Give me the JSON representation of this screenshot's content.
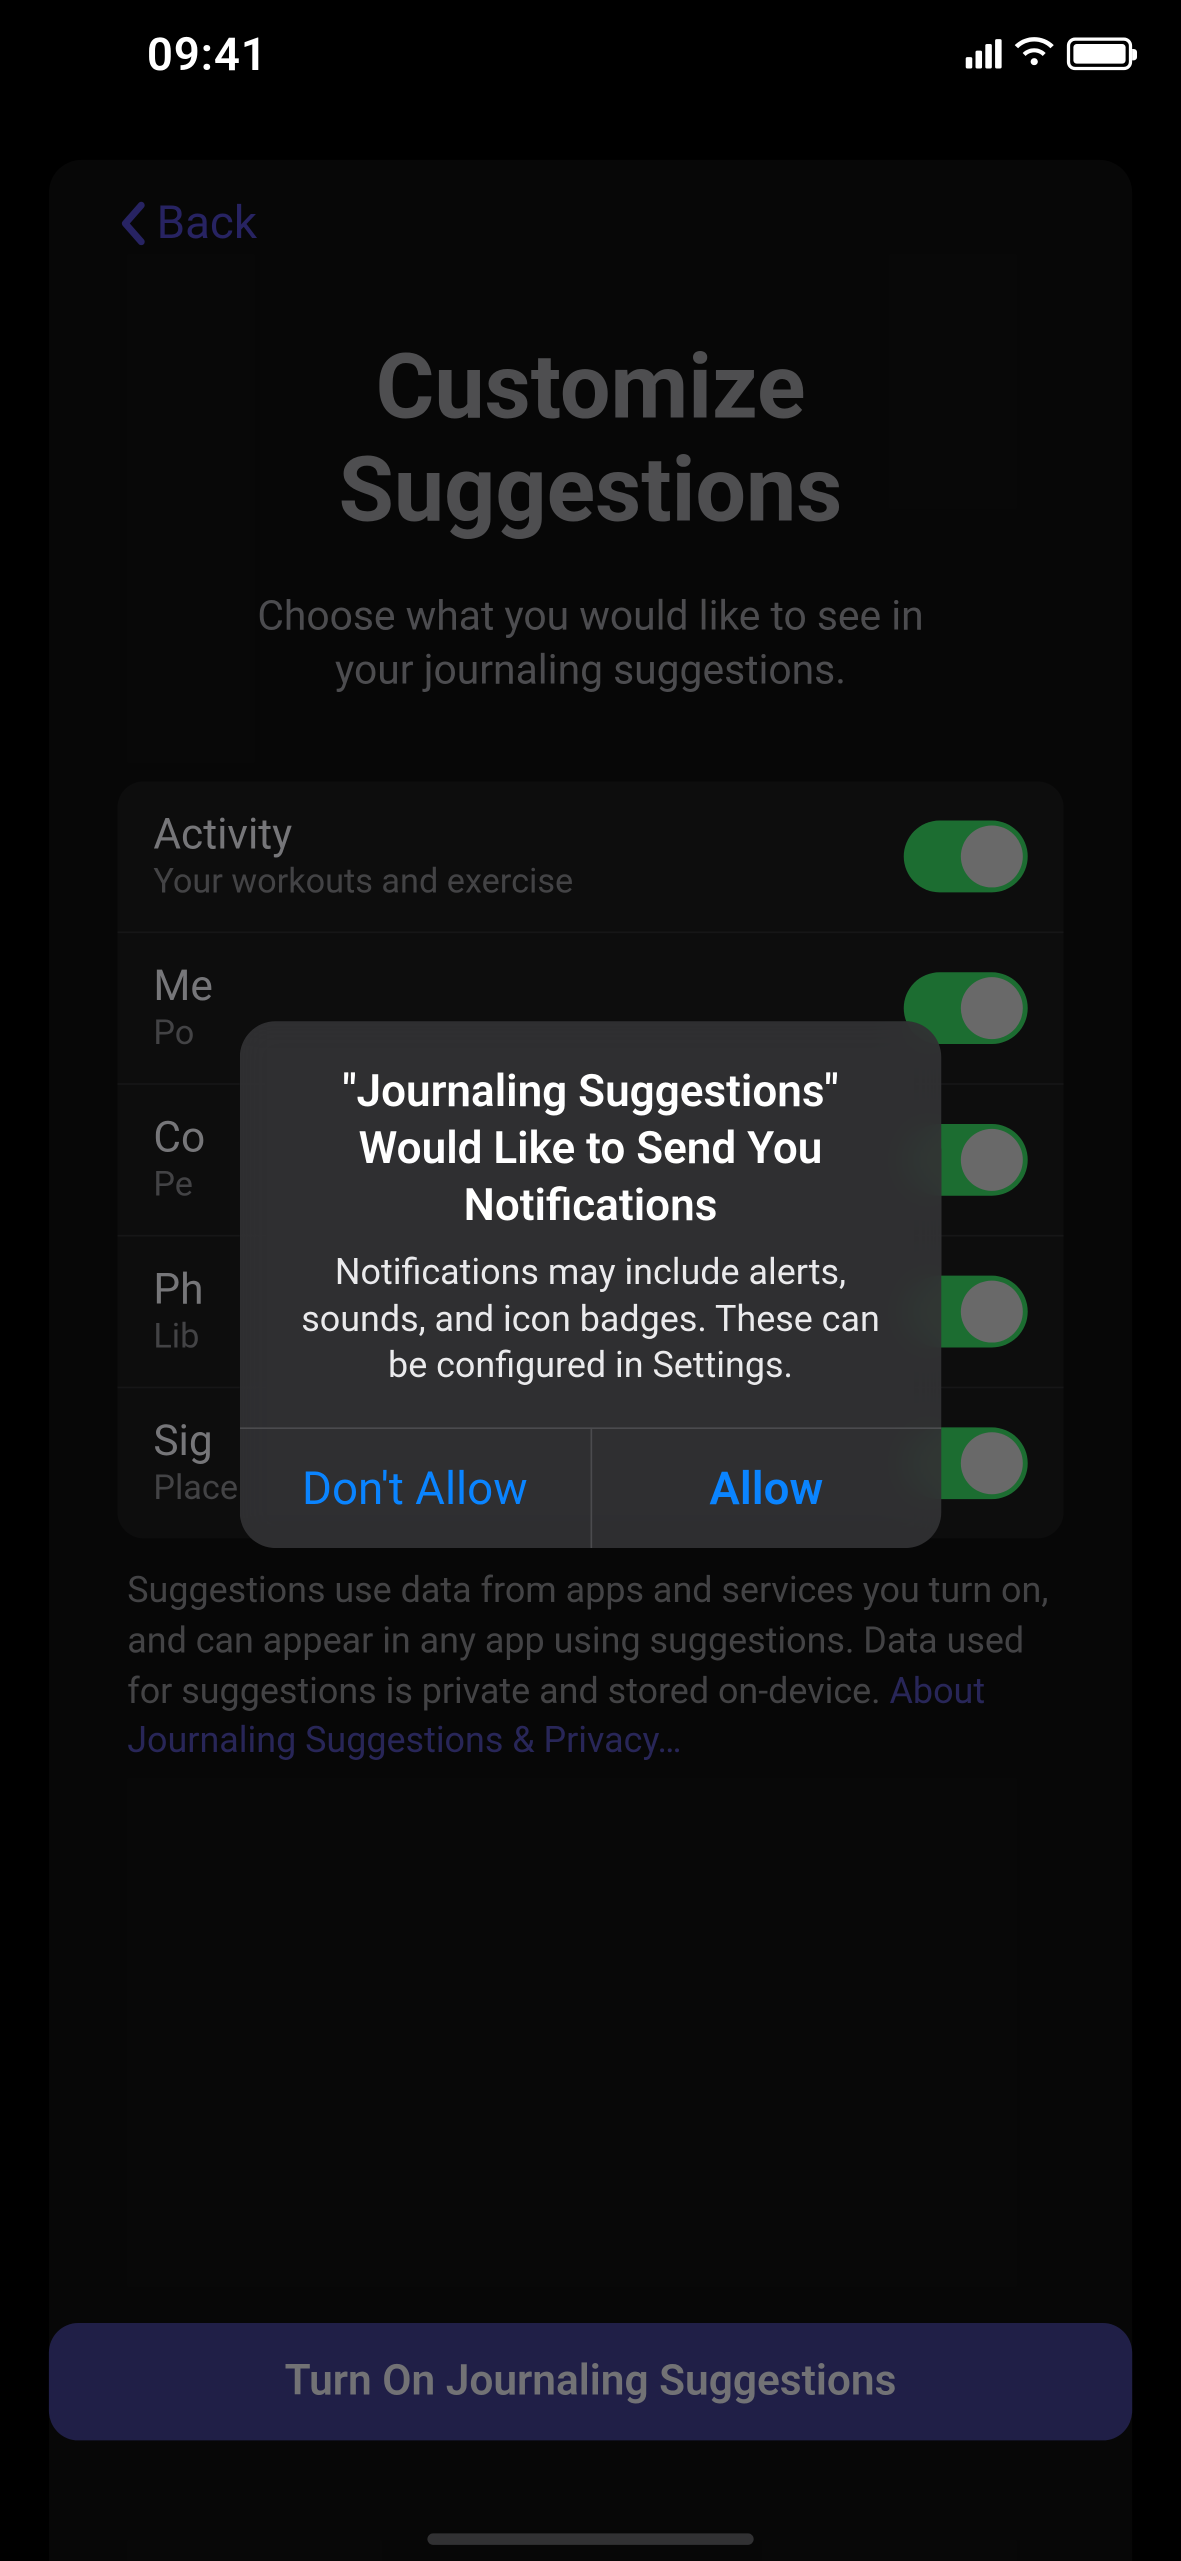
{
  "status": {
    "time": "09:41"
  },
  "nav": {
    "back_label": "Back"
  },
  "page": {
    "title_line1": "Customize",
    "title_line2": "Suggestions",
    "subtitle": "Choose what you would like to see in your journaling suggestions."
  },
  "options": [
    {
      "title": "Activity",
      "sub": "Your workouts and exercise"
    },
    {
      "title": "Me",
      "sub": "Po"
    },
    {
      "title": "Co",
      "sub": "Pe"
    },
    {
      "title": "Ph",
      "sub": "Lib"
    },
    {
      "title": "Sig",
      "sub": "Place"
    }
  ],
  "footer": {
    "text": "Suggestions use data from apps and services you turn on, and can appear in any app using suggestions. Data used for suggestions is private and stored on-device. ",
    "link": "About Journaling Suggestions & Privacy…"
  },
  "primary_button": "Turn On Journaling Suggestions",
  "alert": {
    "title": "\"Journaling Suggestions\" Would Like to Send You Notifications",
    "message": "Notifications may include alerts, sounds, and icon badges. These can be configured in Settings.",
    "deny": "Don't Allow",
    "allow": "Allow"
  }
}
